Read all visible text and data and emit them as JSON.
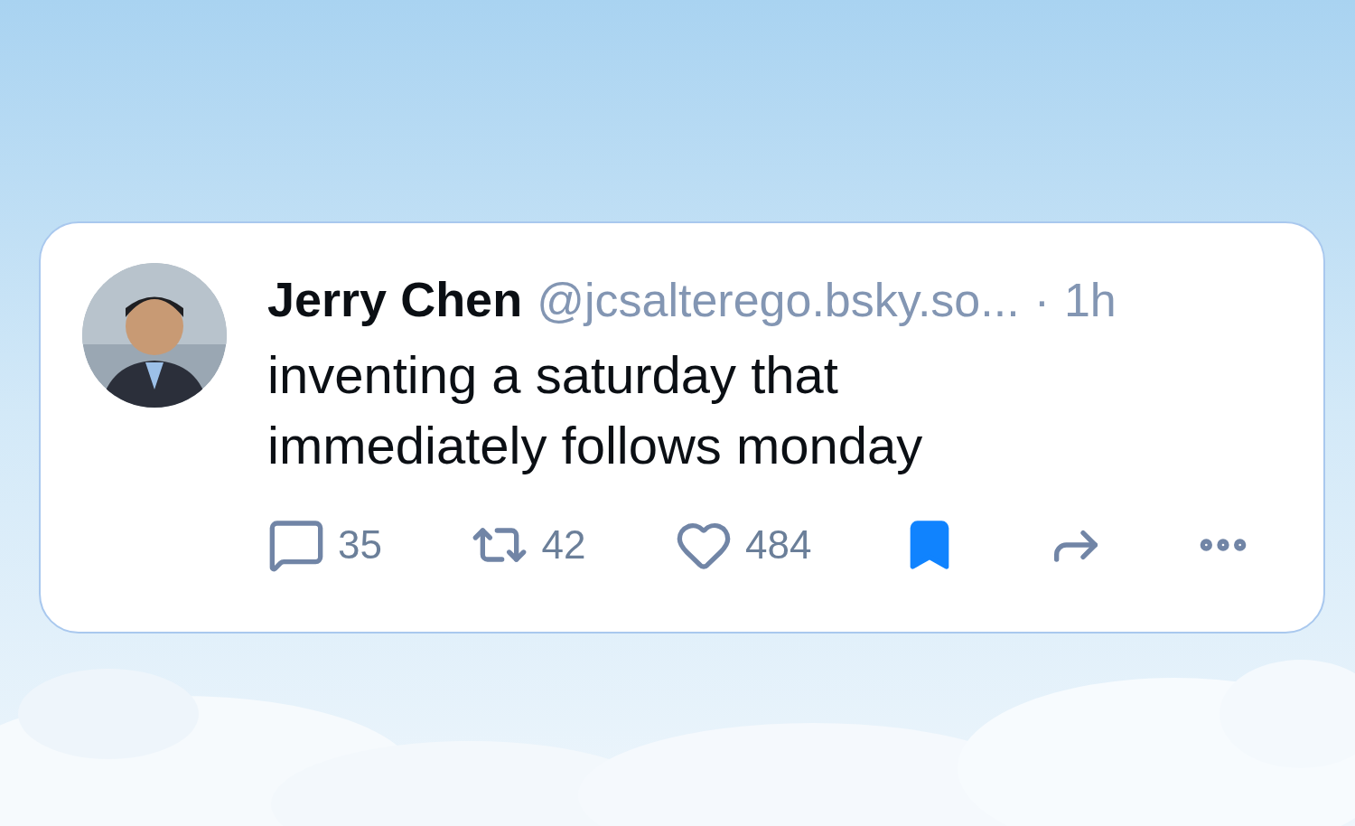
{
  "post": {
    "author": "Jerry Chen",
    "handle": "@jcsalterego.bsky.so...",
    "separator": "·",
    "time": "1h",
    "text": "inventing a saturday that immediately follows monday"
  },
  "actions": [
    {
      "kind": "reply",
      "count": "35"
    },
    {
      "kind": "repost",
      "count": "42"
    },
    {
      "kind": "like",
      "count": "484",
      "liked": false
    },
    {
      "kind": "bookmark",
      "saved": true
    },
    {
      "kind": "share"
    },
    {
      "kind": "more"
    }
  ]
}
